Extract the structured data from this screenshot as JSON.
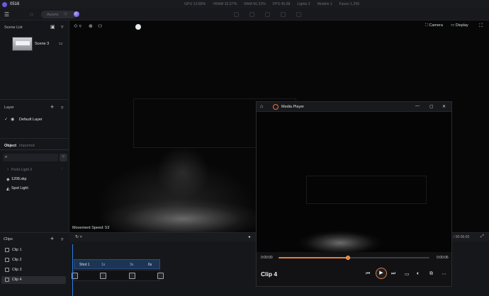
{
  "titlebar": {
    "title": "0516"
  },
  "stats": [
    "GPU 13.89%",
    "VRAM 32.57%",
    "RAM 66.22%",
    "FPS 45.68",
    "Lights 2",
    "Models 1",
    "Faces 1,256"
  ],
  "toolbar": {
    "assets_placeholder": "Assets",
    "icons": [
      "hamburger-menu-icon",
      "chat-icon",
      "material-ball-icon"
    ]
  },
  "scene_list": {
    "title": "Scene List",
    "items": [
      {
        "label": "Scene 3"
      }
    ]
  },
  "layer": {
    "title": "Layer",
    "items": [
      {
        "label": "Default Layer",
        "checked": true
      }
    ]
  },
  "object": {
    "tabs": [
      {
        "label": "Object",
        "active": true
      },
      {
        "label": "Imported",
        "active": false
      }
    ],
    "items": [
      {
        "label": "Point Light 2",
        "dimmed": true
      },
      {
        "label": "1208.skp",
        "dimmed": false
      },
      {
        "label": "Spot Light",
        "dimmed": false
      }
    ]
  },
  "viewport": {
    "movement_speed": "Movement Speed: 53",
    "camera_label": "Camera",
    "display_label": "Display"
  },
  "media_player": {
    "title": "Media Player",
    "time_current": "0:00:00",
    "time_duration": "0:00:06",
    "progress": 0.46,
    "clip_name": "Clip 4",
    "accent": "#e37f38"
  },
  "timeline": {
    "clips_title": "Clips",
    "clips": [
      {
        "label": "Clip 1",
        "selected": false
      },
      {
        "label": "Clip 2",
        "selected": false
      },
      {
        "label": "Clip 3",
        "selected": false
      },
      {
        "label": "Clip 4",
        "selected": true
      }
    ],
    "time_display": "/ 00:06:00",
    "shot_name": "Shot 1",
    "ticks": [
      "1s",
      "3s",
      "6s"
    ]
  }
}
